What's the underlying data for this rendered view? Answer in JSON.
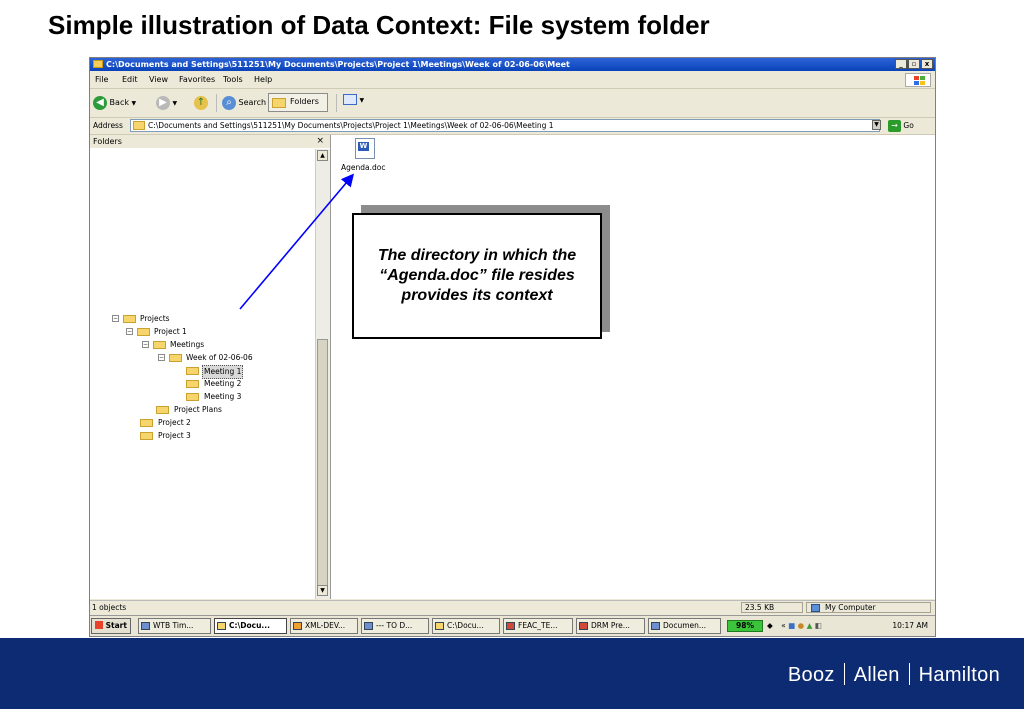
{
  "slide": {
    "title": "Simple illustration of Data Context: File system folder"
  },
  "window": {
    "title": "C:\\Documents and Settings\\511251\\My Documents\\Projects\\Project 1\\Meetings\\Week of 02-06-06\\Meet",
    "controls": {
      "minimize": "_",
      "maximize": "▫",
      "close": "x"
    }
  },
  "menubar": [
    "File",
    "Edit",
    "View",
    "Favorites",
    "Tools",
    "Help"
  ],
  "toolbar": {
    "back": "Back",
    "search": "Search",
    "folders": "Folders"
  },
  "address": {
    "label": "Address",
    "value": "C:\\Documents and Settings\\511251\\My Documents\\Projects\\Project 1\\Meetings\\Week of 02-06-06\\Meeting 1",
    "go": "Go"
  },
  "folders_pane": {
    "header": "Folders",
    "close": "×",
    "tree": [
      {
        "label": "Projects",
        "expander": "⊟"
      },
      {
        "label": "Project 1",
        "expander": "⊟"
      },
      {
        "label": "Meetings",
        "expander": "⊟"
      },
      {
        "label": "Week of 02-06-06",
        "expander": "⊟"
      },
      {
        "label": "Meeting 1",
        "selected": true
      },
      {
        "label": "Meeting 2"
      },
      {
        "label": "Meeting 3"
      },
      {
        "label": "Project Plans"
      },
      {
        "label": "Project 2"
      },
      {
        "label": "Project 3"
      }
    ]
  },
  "content": {
    "file": {
      "name": "Agenda.doc",
      "icon": "word-document-icon"
    }
  },
  "statusbar": {
    "objects": "1 objects",
    "size": "23.5 KB",
    "zone": "My Computer"
  },
  "taskbar": {
    "start": "Start",
    "buttons": [
      "WTB Tim...",
      "C:\\Docu...",
      "XML-DEV...",
      "--- TO D...",
      "C:\\Docu...",
      "FEAC_TE...",
      "DRM Pre...",
      "Documen..."
    ],
    "battery": "98%",
    "clock": "10:17 AM"
  },
  "callout": {
    "text": "The directory in which the “Agenda.doc” file resides provides its context"
  },
  "footer": {
    "brand": [
      "Booz",
      "Allen",
      "Hamilton"
    ]
  },
  "colors": {
    "footer": "#0d2b73",
    "titlebar": "#0a43b9",
    "arrow": "#0000ff"
  }
}
